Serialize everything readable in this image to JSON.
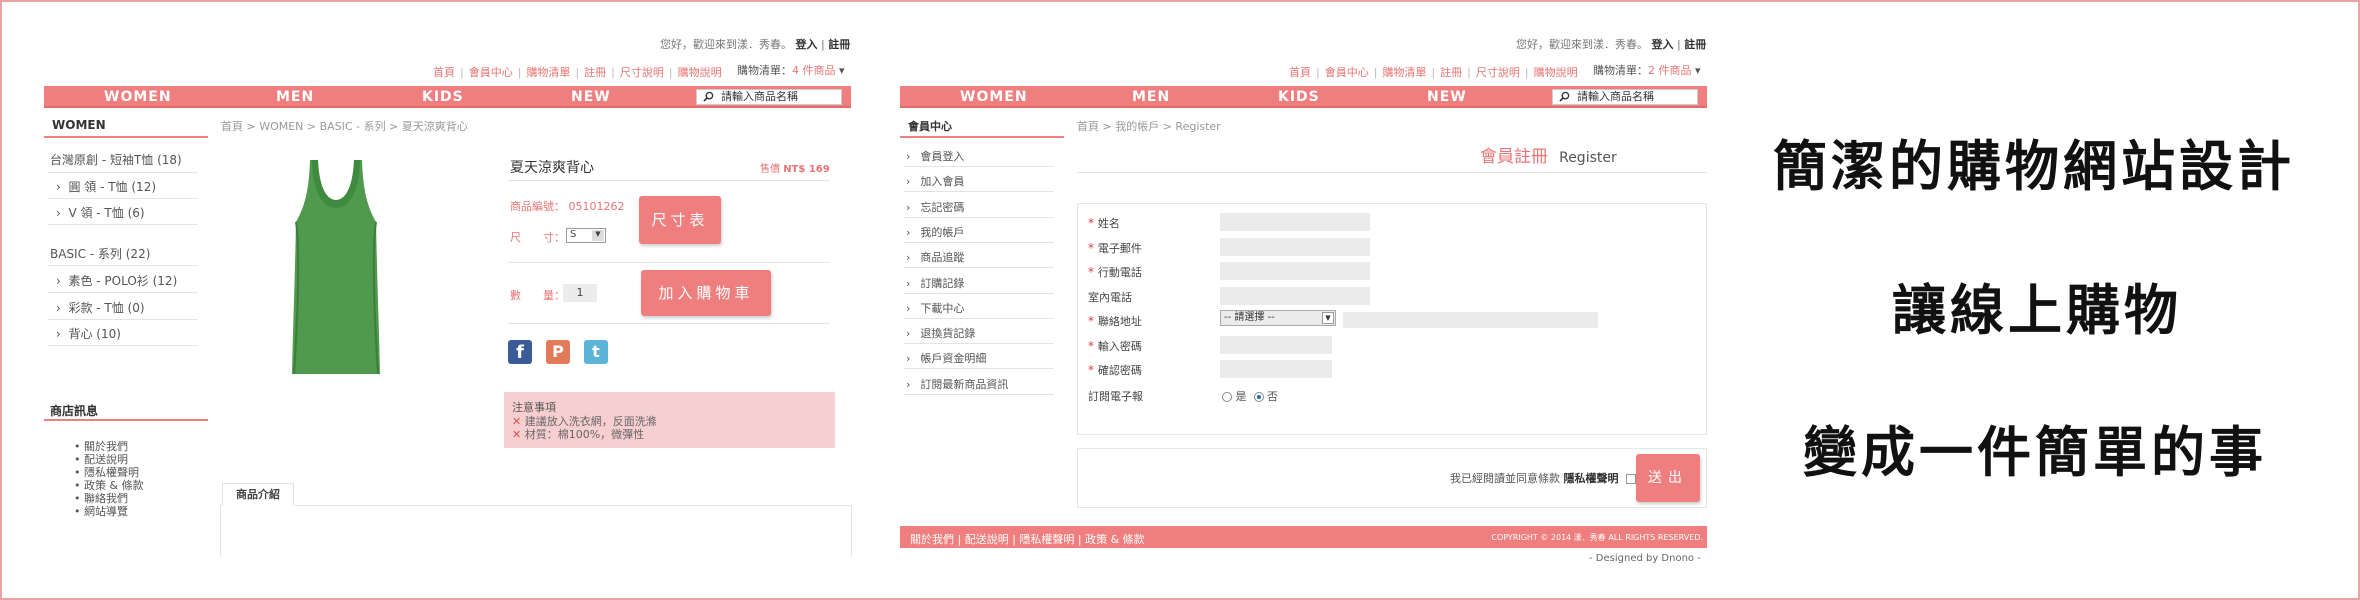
{
  "colors": {
    "accent": "#ef7e7e",
    "frame": "#e8a3a5"
  },
  "panel1": {
    "greeting": "您好，歡迎來到漾．秀春。",
    "login": "登入",
    "register": "註冊",
    "subnav": [
      "首頁",
      "會員中心",
      "購物清單",
      "註冊",
      "尺寸說明",
      "購物說明"
    ],
    "cart_label": "購物清單：",
    "cart_count": "4 件商品",
    "nav": [
      "WOMEN",
      "MEN",
      "KIDS",
      "NEW"
    ],
    "search_placeholder": "請輸入商品名稱",
    "sidebar_title": "WOMEN",
    "side_items": [
      "台灣原創 - 短袖T恤 (18)",
      "圓 領 - T恤 (12)",
      "V 領 - T恤 (6)",
      "BASIC - 系列 (22)",
      "素色 - POLO衫 (12)",
      "彩款 - T恤 (0)",
      "背心 (10)"
    ],
    "store_title": "商店訊息",
    "store_links": [
      "關於我們",
      "配送說明",
      "隱私權聲明",
      "政策 & 條款",
      "聯絡我們",
      "網站導覽"
    ],
    "breadcrumb": "首頁 > WOMEN > BASIC - 系列 > 夏天涼爽背心",
    "product_name": "夏天涼爽背心",
    "price_label": "售價",
    "price": "NT$ 169",
    "code_label": "商品編號：",
    "code": "05101262",
    "size_label": "尺　　寸：",
    "size_value": "S",
    "size_btn": "尺寸表",
    "qty_label": "數　　量：",
    "qty": "1",
    "cart_btn": "加入購物車",
    "notice_title": "注意事項",
    "notices": [
      "建議放入洗衣網，反面洗滌",
      "材質：棉100%，微彈性"
    ],
    "tab": "商品介紹"
  },
  "panel2": {
    "greeting": "您好，歡迎來到漾．秀春。",
    "login": "登入",
    "register": "註冊",
    "subnav": [
      "首頁",
      "會員中心",
      "購物清單",
      "註冊",
      "尺寸說明",
      "購物說明"
    ],
    "cart_label": "購物清單：",
    "cart_count": "2 件商品",
    "nav": [
      "WOMEN",
      "MEN",
      "KIDS",
      "NEW"
    ],
    "search_placeholder": "請輸入商品名稱",
    "sidebar_title": "會員中心",
    "side_items": [
      "會員登入",
      "加入會員",
      "忘記密碼",
      "我的帳戶",
      "商品追蹤",
      "訂購記錄",
      "下載中心",
      "退換貨記錄",
      "帳戶資金明細",
      "訂閱最新商品資訊"
    ],
    "breadcrumb": "首頁 > 我的帳戶 > Register",
    "title_cn": "會員註冊",
    "title_en": "Register",
    "fields": [
      "姓名",
      "電子郵件",
      "行動電話",
      "室內電話",
      "聯絡地址",
      "輸入密碼",
      "確認密碼",
      "訂閱電子報"
    ],
    "select_placeholder": "-- 請選擇 --",
    "yes": "是",
    "no": "否",
    "agree": "我已經閱讀並同意條款",
    "privacy": "隱私權聲明",
    "submit": "送出",
    "footer_links": [
      "關於我們",
      "配送說明",
      "隱私權聲明",
      "政策 & 條款"
    ],
    "copyright": "COPYRIGHT © 2014 漾．秀春 ALL RIGHTS RESERVED.",
    "designed": "- Designed by Dnono -"
  },
  "captions": [
    "簡潔的購物網站設計",
    "讓線上購物",
    "變成一件簡單的事"
  ]
}
